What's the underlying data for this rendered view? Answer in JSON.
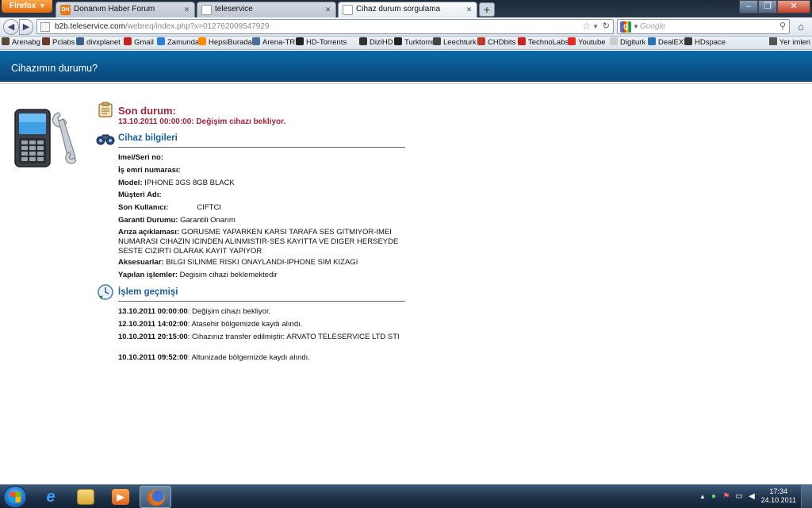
{
  "browser": {
    "menu_label": "Firefox",
    "tabs": [
      {
        "label": "Donanım Haber Forum",
        "icon": "dh-icon",
        "active": false
      },
      {
        "label": "teleservice",
        "icon": "page-icon",
        "active": false
      },
      {
        "label": "Cihaz durum sorgulama",
        "icon": "page-icon",
        "active": true
      }
    ],
    "url_host": "b2b.teleservice.com",
    "url_rest": "/webreq/index.php?x=012762009547929",
    "search_placeholder": "Google",
    "bookmarks": [
      {
        "label": "Arenabg",
        "color": "#5a4a3a"
      },
      {
        "label": "Pclabs",
        "color": "#6b3a2a"
      },
      {
        "label": "divxplanet",
        "color": "#3c5f8a"
      },
      {
        "label": "Gmail",
        "color": "#c5221f"
      },
      {
        "label": "Zamunda",
        "color": "#2b7fd6"
      },
      {
        "label": "HepsiBurada",
        "color": "#ff8a00"
      },
      {
        "label": "Arena-TR",
        "color": "#4b6f9a"
      },
      {
        "label": "HD-Torrents",
        "color": "#222222"
      },
      {
        "label": "DiziHD",
        "color": "#333333"
      },
      {
        "label": "Turktorrent",
        "color": "#222222"
      },
      {
        "label": "Leechturk",
        "color": "#444444"
      },
      {
        "label": "CHDbits",
        "color": "#c0392b"
      },
      {
        "label": "TechnoLabs",
        "color": "#cc2222"
      },
      {
        "label": "Youtube",
        "color": "#e52d27"
      },
      {
        "label": "Digiturk",
        "color": "#cccccc"
      },
      {
        "label": "DealEX",
        "color": "#2a73b8"
      },
      {
        "label": "HDspace",
        "color": "#3a3a3a"
      }
    ],
    "bookmarks_more": "Yer imleri"
  },
  "page": {
    "header_title": "Cihazımın durumu?",
    "son_durum_title": "Son durum:",
    "son_durum_value": "13.10.2011 00:00:00: Değişim cihazı bekliyor.",
    "device_section_title": "Cihaz bilgileri",
    "device_fields": {
      "imei_label": "Imei/Seri no:",
      "is_emri_label": "İş emri numarası:",
      "model_label": "Model:",
      "model_value": "IPHONE 3GS 8GB BLACK",
      "musteri_label": "Müşteri Adı:",
      "son_kullanici_label": "Son Kullanıcı:",
      "son_kullanici_value": "CIFTCI",
      "garanti_label": "Garanti Durumu:",
      "garanti_value": "Garantili Onarım",
      "ariza_label": "Arıza açıklaması:",
      "ariza_value": "GORUSME YAPARKEN KARSI TARAFA SES GITMIYOR-IMEI NUMARASI CIHAZIN ICINDEN ALINMISTIR-SES KAYITTA VE DIGER HERSEYDE SESTE CIZIRTI OLARAK KAYIT YAPIYOR",
      "aksesuar_label": "Aksesuarlar:",
      "aksesuar_value": "BILGI SILINME RISKI ONAYLANDI-IPHONE SIM KIZAGI",
      "yapilan_label": "Yapılan işlemler:",
      "yapilan_value": "Degisim cihazi beklemektedir"
    },
    "history_section_title": "İşlem geçmişi",
    "history": [
      {
        "time": "13.10.2011 00:00:00",
        "text": ": Değişim cihazı bekliyor."
      },
      {
        "time": "12.10.2011 14:02:00",
        "text": ": Atasehir bölgemizde kaydı alındı."
      },
      {
        "time": "10.10.2011 20:15:00",
        "text": ": Cihazınız transfer edilmiştir: ARVATO TELESERVICE LTD STI"
      },
      {
        "time": "10.10.2011 09:52:00",
        "text": ": Altunizade bölgemizde kaydı alındı."
      }
    ]
  },
  "taskbar": {
    "clock_time": "17:34",
    "clock_date": "24.10.2011",
    "apps": [
      "ie-icon",
      "explorer-folder-icon",
      "media-player-icon",
      "firefox-icon"
    ]
  }
}
